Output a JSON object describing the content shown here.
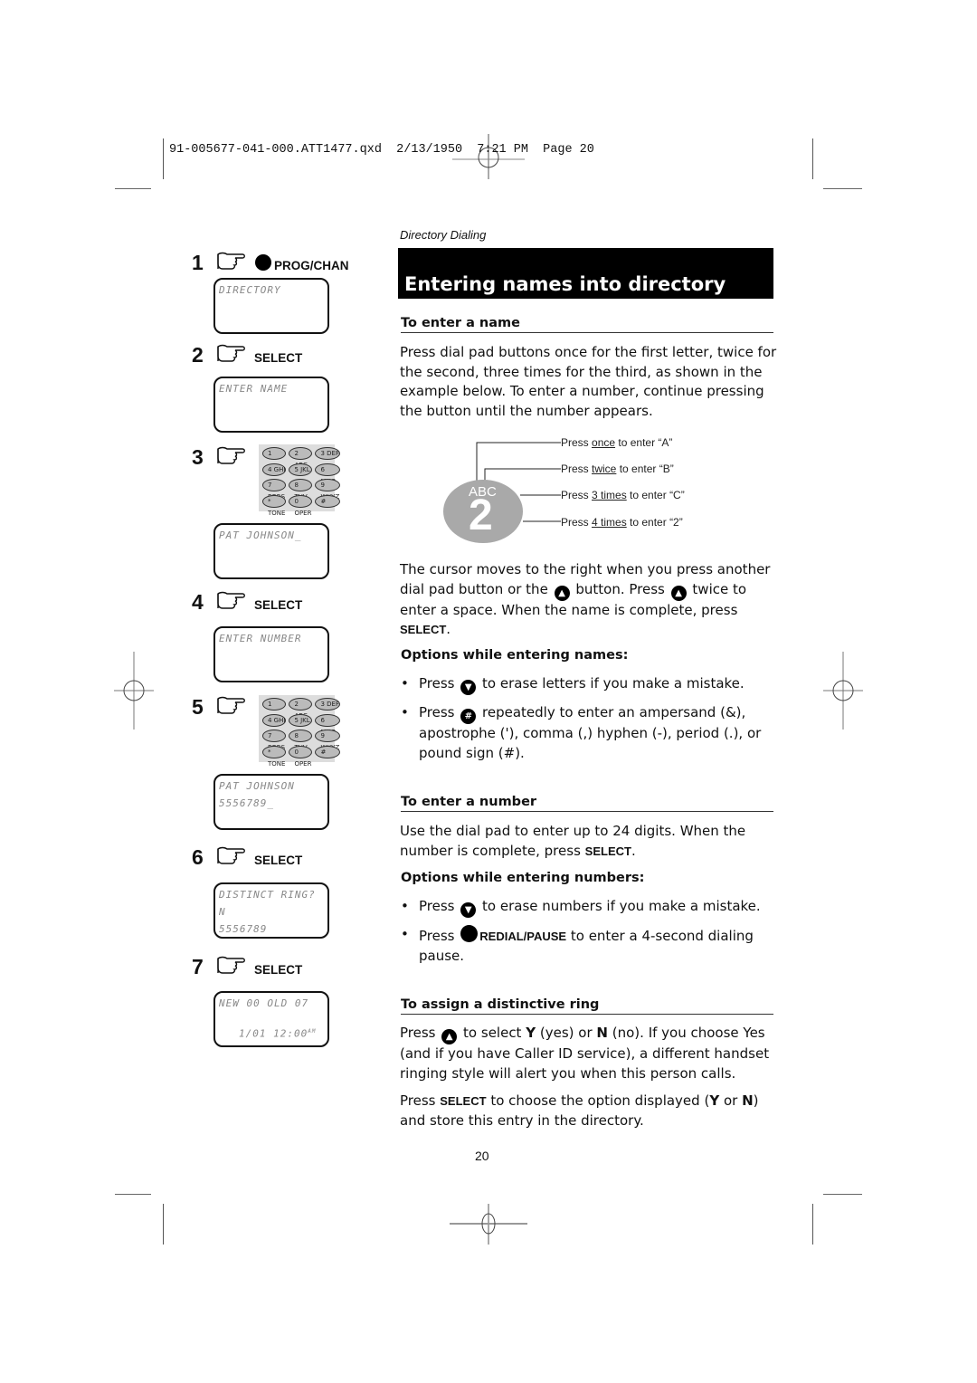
{
  "slug": "91-005677-041-000.ATT1477.qxd  2/13/1950  7:21 PM  Page 20",
  "section_tag": "Directory Dialing",
  "title": "Entering names into directory",
  "steps": [
    {
      "num": "1",
      "key": "PROG/CHAN",
      "key_icon": "round-button-icon",
      "lcd": [
        "DIRECTORY",
        ""
      ]
    },
    {
      "num": "2",
      "key": "SELECT",
      "lcd": [
        "ENTER NAME",
        ""
      ]
    },
    {
      "num": "3",
      "key": "",
      "keypad": true,
      "lcd": [
        "PAT JOHNSON_",
        ""
      ]
    },
    {
      "num": "4",
      "key": "SELECT",
      "lcd": [
        "ENTER NUMBER",
        ""
      ]
    },
    {
      "num": "5",
      "key": "",
      "keypad": true,
      "lcd": [
        "PAT JOHNSON",
        "5556789_"
      ]
    },
    {
      "num": "6",
      "key": "SELECT",
      "lcd": [
        "DISTINCT RING? N",
        "5556789"
      ]
    },
    {
      "num": "7",
      "key": "SELECT",
      "lcd": [
        "NEW 00   OLD 07",
        "1/01  12:00",
        "AM"
      ]
    }
  ],
  "keypad_keys": [
    "1",
    "2 ABC",
    "3 DEF",
    "4 GHI",
    "5 JKL",
    "6 MNO",
    "7 PQRS",
    "8 TUV",
    "9 WXYZ",
    "* TONE",
    "0 OPER",
    "#"
  ],
  "enter_name": {
    "heading": "To enter a name",
    "body": "Press dial pad buttons once for the first letter, twice for the second, three times for the third, as shown in the example below. To enter a number, continue pressing the button until the number appears.",
    "diagram": {
      "letters": "ABC",
      "digit": "2",
      "callouts": [
        {
          "pre": "Press ",
          "u": "once",
          "post": " to enter “A”"
        },
        {
          "pre": "Press ",
          "u": "twice",
          "post": " to enter “B”"
        },
        {
          "pre": "Press ",
          "u": "3 times",
          "post": " to enter “C”"
        },
        {
          "pre": "Press ",
          "u": "4 times",
          "post": " to enter “2”"
        }
      ]
    },
    "cursor_p1": "The cursor moves to the right when you press another dial pad button or the",
    "cursor_p2": "button. Press",
    "cursor_p3": "twice to enter a space. When the name is complete, press",
    "cursor_select": "SELECT",
    "options_heading": "Options while entering names:",
    "bullets": [
      {
        "pre": "Press",
        "icon": "down-arrow-button-icon",
        "post": "to erase letters if you make a mistake."
      },
      {
        "pre": "Press",
        "icon": "pound-button-icon",
        "post": "repeatedly to enter an ampersand (&), apostrophe ('), comma (,) hyphen (-), period (.), or pound sign (#)."
      }
    ]
  },
  "enter_number": {
    "heading": "To enter a number",
    "body_pre": "Use the dial pad to enter up to 24 digits. When the number is complete, press",
    "body_select": "SELECT",
    "options_heading": "Options while entering numbers:",
    "bullets": [
      {
        "pre": "Press",
        "icon": "down-arrow-button-icon",
        "post": "to erase numbers if you make a mistake."
      },
      {
        "pre": "Press",
        "icon": "round-button-icon",
        "key": "REDIAL/PAUSE",
        "post": "to enter a 4-second dialing pause."
      }
    ]
  },
  "distinctive_ring": {
    "heading": "To assign a distinctive ring",
    "p1_pre": "Press",
    "p1_mid": "to select",
    "y": "Y",
    "yes": "(yes) or",
    "n": "N",
    "p1_post": "(no). If you choose Yes (and if you have Caller ID service), a different handset ringing style will alert you when this person calls.",
    "p2_pre": "Press",
    "p2_select": "SELECT",
    "p2_mid": "to choose the option displayed (",
    "p2_or": "or",
    "p2_post": ") and store this entry in the directory."
  },
  "page_number": "20"
}
